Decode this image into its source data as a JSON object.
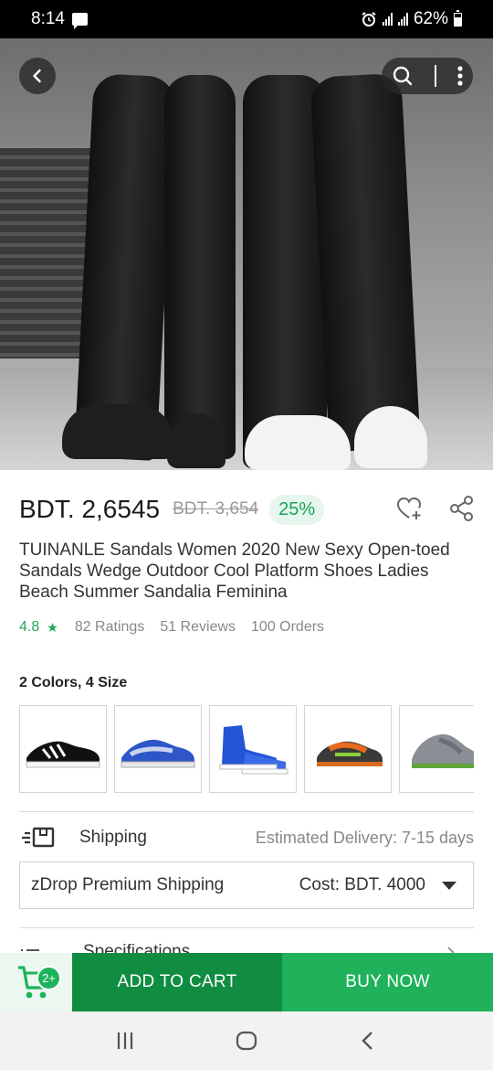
{
  "status_bar": {
    "time": "8:14",
    "battery": "62%"
  },
  "hero": {
    "image_desc": "two people in black cargo jogger pants and sneakers"
  },
  "product": {
    "price": "BDT. 2,6545",
    "old_price": "BDT. 3,654",
    "discount": "25%",
    "title": "TUINANLE Sandals Women 2020 New Sexy Open-toed Sandals Wedge Outdoor Cool Platform Shoes Ladies Beach Summer Sandalia Feminina",
    "rating": "4.8",
    "ratings": "82 Ratings",
    "reviews": "51 Reviews",
    "orders": "100 Orders"
  },
  "variants": {
    "label": "2 Colors, 4 Size",
    "items": [
      "black-white-sneaker",
      "blue-gray-sneaker",
      "blue-high-top-sneaker",
      "orange-green-sneaker",
      "gray-green-sneaker"
    ]
  },
  "shipping": {
    "label": "Shipping",
    "delivery": "Estimated Delivery: 7-15 days",
    "method": "zDrop Premium Shipping",
    "cost": "Cost: BDT. 4000"
  },
  "specifications": {
    "label": "Specifications"
  },
  "actions": {
    "cart_count": "2+",
    "add_to_cart": "ADD TO CART",
    "buy_now": "BUY NOW"
  },
  "colors": {
    "accent": "#1fb25a",
    "accent_dark": "#108d41",
    "cart_bg": "#eaf8ef"
  }
}
